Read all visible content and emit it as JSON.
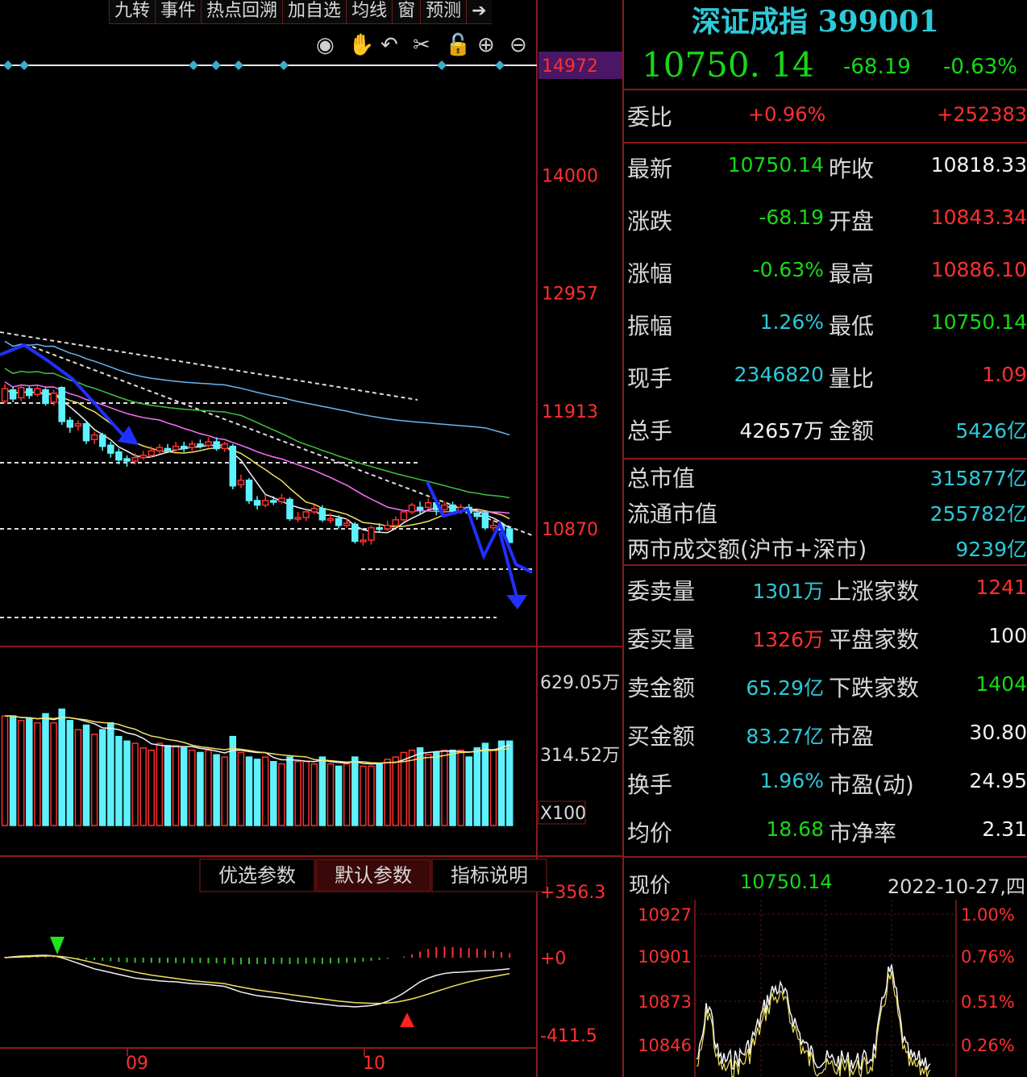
{
  "toolbar": [
    "九转",
    "事件",
    "热点回溯",
    "加自选",
    "均线",
    "窗",
    "预测"
  ],
  "header": {
    "title": "深证成指 399001",
    "price": "10750. 14",
    "change": "-68.19",
    "change_pct": "-0.63%"
  },
  "weibi": {
    "label": "委比",
    "pct": "+0.96%",
    "value": "+252383"
  },
  "quote_rows": [
    {
      "l1": "最新",
      "v1": "10750.14",
      "c1": "g",
      "l2": "昨收",
      "v2": "10818.33",
      "c2": "w"
    },
    {
      "l1": "涨跌",
      "v1": "-68.19",
      "c1": "g",
      "l2": "开盘",
      "v2": "10843.34",
      "c2": "r"
    },
    {
      "l1": "涨幅",
      "v1": "-0.63%",
      "c1": "g",
      "l2": "最高",
      "v2": "10886.10",
      "c2": "r"
    },
    {
      "l1": "振幅",
      "v1": "1.26%",
      "c1": "c",
      "l2": "最低",
      "v2": "10750.14",
      "c2": "g"
    },
    {
      "l1": "现手",
      "v1": "2346820",
      "c1": "c",
      "l2": "量比",
      "v2": "1.09",
      "c2": "r"
    },
    {
      "l1": "总手",
      "v1": "42657万",
      "c1": "w",
      "l2": "金额",
      "v2": "5426亿",
      "c2": "c"
    }
  ],
  "market_rows": [
    {
      "label": "总市值",
      "value": "315877亿"
    },
    {
      "label": "流通市值",
      "value": "255782亿"
    },
    {
      "label": "两市成交额(沪市+深市)",
      "value": "9239亿"
    }
  ],
  "order_rows": [
    {
      "l1": "委卖量",
      "v1": "1301万",
      "c1": "c",
      "l2": "上涨家数",
      "v2": "1241",
      "c2": "r"
    },
    {
      "l1": "委买量",
      "v1": "1326万",
      "c1": "r",
      "l2": "平盘家数",
      "v2": "100",
      "c2": "w"
    },
    {
      "l1": "卖金额",
      "v1": "65.29亿",
      "c1": "c",
      "l2": "下跌家数",
      "v2": "1404",
      "c2": "g"
    },
    {
      "l1": "买金额",
      "v1": "83.27亿",
      "c1": "c",
      "l2": "市盈",
      "v2": "30.80",
      "c2": "w"
    },
    {
      "l1": "换手",
      "v1": "1.96%",
      "c1": "c",
      "l2": "市盈(动)",
      "v2": "24.95",
      "c2": "w"
    },
    {
      "l1": "均价",
      "v1": "18.68",
      "c1": "g",
      "l2": "市净率",
      "v2": "2.31",
      "c2": "w"
    }
  ],
  "mini_chart": {
    "label": "现价",
    "price": "10750.14",
    "date": "2022-10-27,四",
    "left_ticks": [
      "10927",
      "10901",
      "10873",
      "10846"
    ],
    "right_ticks": [
      "1.00%",
      "0.76%",
      "0.51%",
      "0.26%"
    ]
  },
  "indicator_tabs": [
    "优选参数",
    "默认参数",
    "指标说明"
  ],
  "chart_data": {
    "type": "candlestick",
    "price_axis_ticks": [
      "14972",
      "14000",
      "12957",
      "11913",
      "10870"
    ],
    "price_axis_values": [
      14972,
      14000,
      12957,
      11913,
      10870
    ],
    "volume_axis_ticks": [
      "629.05万",
      "314.52万",
      "X100"
    ],
    "macd_axis_ticks": [
      "+356.3",
      "+0",
      "-411.5"
    ],
    "x_labels": [
      "09",
      "10"
    ],
    "candles": [
      {
        "o": 12000,
        "c": 12110,
        "h": 12150,
        "l": 11980
      },
      {
        "o": 12100,
        "c": 12020,
        "h": 12130,
        "l": 11990
      },
      {
        "o": 12030,
        "c": 12120,
        "h": 12140,
        "l": 12000
      },
      {
        "o": 12110,
        "c": 12050,
        "h": 12130,
        "l": 12020
      },
      {
        "o": 12060,
        "c": 12110,
        "h": 12140,
        "l": 12040
      },
      {
        "o": 12100,
        "c": 11980,
        "h": 12120,
        "l": 11960
      },
      {
        "o": 11990,
        "c": 12070,
        "h": 12100,
        "l": 11960
      },
      {
        "o": 12120,
        "c": 11820,
        "h": 12130,
        "l": 11790
      },
      {
        "o": 11830,
        "c": 11770,
        "h": 11860,
        "l": 11720
      },
      {
        "o": 11780,
        "c": 11800,
        "h": 11830,
        "l": 11740
      },
      {
        "o": 11800,
        "c": 11650,
        "h": 11820,
        "l": 11620
      },
      {
        "o": 11660,
        "c": 11700,
        "h": 11730,
        "l": 11620
      },
      {
        "o": 11700,
        "c": 11600,
        "h": 11720,
        "l": 11560
      },
      {
        "o": 11610,
        "c": 11540,
        "h": 11640,
        "l": 11500
      },
      {
        "o": 11550,
        "c": 11480,
        "h": 11580,
        "l": 11440
      },
      {
        "o": 11490,
        "c": 11470,
        "h": 11520,
        "l": 11420
      },
      {
        "o": 11470,
        "c": 11500,
        "h": 11540,
        "l": 11440
      },
      {
        "o": 11500,
        "c": 11520,
        "h": 11560,
        "l": 11480
      },
      {
        "o": 11520,
        "c": 11560,
        "h": 11600,
        "l": 11500
      },
      {
        "o": 11560,
        "c": 11590,
        "h": 11620,
        "l": 11530
      },
      {
        "o": 11580,
        "c": 11570,
        "h": 11620,
        "l": 11540
      },
      {
        "o": 11570,
        "c": 11600,
        "h": 11640,
        "l": 11550
      },
      {
        "o": 11600,
        "c": 11580,
        "h": 11640,
        "l": 11550
      },
      {
        "o": 11590,
        "c": 11620,
        "h": 11650,
        "l": 11560
      },
      {
        "o": 11620,
        "c": 11610,
        "h": 11660,
        "l": 11580
      },
      {
        "o": 11610,
        "c": 11640,
        "h": 11680,
        "l": 11590
      },
      {
        "o": 11640,
        "c": 11580,
        "h": 11680,
        "l": 11560
      },
      {
        "o": 11580,
        "c": 11620,
        "h": 11640,
        "l": 11550
      },
      {
        "o": 11600,
        "c": 11250,
        "h": 11620,
        "l": 11220
      },
      {
        "o": 11260,
        "c": 11300,
        "h": 11350,
        "l": 11230
      },
      {
        "o": 11300,
        "c": 11120,
        "h": 11320,
        "l": 11090
      },
      {
        "o": 11120,
        "c": 11080,
        "h": 11160,
        "l": 11040
      },
      {
        "o": 11080,
        "c": 11120,
        "h": 11170,
        "l": 11060
      },
      {
        "o": 11120,
        "c": 11110,
        "h": 11160,
        "l": 11080
      },
      {
        "o": 11110,
        "c": 11140,
        "h": 11180,
        "l": 11090
      },
      {
        "o": 11130,
        "c": 10960,
        "h": 11150,
        "l": 10940
      },
      {
        "o": 10960,
        "c": 10970,
        "h": 11020,
        "l": 10930
      },
      {
        "o": 10970,
        "c": 11020,
        "h": 11040,
        "l": 10940
      },
      {
        "o": 11020,
        "c": 11050,
        "h": 11080,
        "l": 11000
      },
      {
        "o": 11050,
        "c": 10950,
        "h": 11080,
        "l": 10930
      },
      {
        "o": 10950,
        "c": 10960,
        "h": 11010,
        "l": 10920
      },
      {
        "o": 10960,
        "c": 10900,
        "h": 10990,
        "l": 10870
      },
      {
        "o": 10900,
        "c": 10920,
        "h": 10960,
        "l": 10880
      },
      {
        "o": 10910,
        "c": 10760,
        "h": 10930,
        "l": 10740
      },
      {
        "o": 10760,
        "c": 10770,
        "h": 10830,
        "l": 10720
      },
      {
        "o": 10770,
        "c": 10880,
        "h": 10900,
        "l": 10730
      },
      {
        "o": 10880,
        "c": 10870,
        "h": 10920,
        "l": 10840
      },
      {
        "o": 10870,
        "c": 10900,
        "h": 10940,
        "l": 10850
      },
      {
        "o": 10900,
        "c": 10950,
        "h": 10980,
        "l": 10880
      },
      {
        "o": 10950,
        "c": 11020,
        "h": 11040,
        "l": 10930
      },
      {
        "o": 11020,
        "c": 11080,
        "h": 11100,
        "l": 11000
      },
      {
        "o": 11060,
        "c": 11040,
        "h": 11110,
        "l": 11000
      },
      {
        "o": 11060,
        "c": 11100,
        "h": 11140,
        "l": 11040
      },
      {
        "o": 11100,
        "c": 11040,
        "h": 11120,
        "l": 10990
      },
      {
        "o": 11040,
        "c": 11080,
        "h": 11110,
        "l": 11010
      },
      {
        "o": 11080,
        "c": 11030,
        "h": 11110,
        "l": 11000
      },
      {
        "o": 11030,
        "c": 11060,
        "h": 11090,
        "l": 11000
      },
      {
        "o": 11060,
        "c": 11010,
        "h": 11090,
        "l": 10980
      },
      {
        "o": 11010,
        "c": 10980,
        "h": 11030,
        "l": 10950
      },
      {
        "o": 11010,
        "c": 10880,
        "h": 11030,
        "l": 10860
      },
      {
        "o": 10880,
        "c": 10900,
        "h": 10950,
        "l": 10850
      },
      {
        "o": 10900,
        "c": 10860,
        "h": 10920,
        "l": 10830
      },
      {
        "o": 10870,
        "c": 10750,
        "h": 10890,
        "l": 10750
      }
    ],
    "volume_values": [
      4.8,
      4.8,
      4.6,
      4.7,
      4.5,
      4.9,
      4.5,
      5.1,
      4.6,
      4.2,
      4.4,
      4.0,
      4.2,
      4.5,
      3.9,
      3.7,
      3.6,
      3.4,
      3.3,
      3.6,
      3.5,
      3.5,
      3.4,
      3.3,
      3.2,
      3.3,
      3.1,
      3.0,
      3.9,
      3.2,
      3.0,
      2.9,
      3.0,
      2.8,
      2.7,
      3.0,
      2.8,
      2.8,
      2.7,
      3.0,
      2.7,
      2.6,
      2.7,
      3.0,
      2.6,
      2.6,
      2.7,
      2.9,
      3.0,
      3.2,
      3.3,
      3.4,
      3.1,
      3.2,
      3.3,
      3.3,
      3.3,
      3.0,
      3.4,
      3.6,
      3.3,
      3.7,
      3.7
    ],
    "macd_hist": [
      10,
      10,
      12,
      12,
      14,
      15,
      13,
      8,
      2,
      -8,
      -15,
      -22,
      -28,
      -32,
      -38,
      -42,
      -46,
      -44,
      -46,
      -48,
      -46,
      -48,
      -50,
      -50,
      -48,
      -52,
      -50,
      -54,
      -62,
      -60,
      -58,
      -56,
      -58,
      -56,
      -55,
      -58,
      -56,
      -54,
      -52,
      -56,
      -52,
      -50,
      -46,
      -44,
      -36,
      -28,
      -20,
      -10,
      0,
      10,
      30,
      55,
      80,
      95,
      100,
      96,
      90,
      85,
      80,
      70,
      60,
      50,
      40
    ],
    "macd_dif": [
      0,
      5,
      8,
      10,
      12,
      13,
      10,
      0,
      -15,
      -30,
      -45,
      -60,
      -70,
      -80,
      -90,
      -100,
      -110,
      -115,
      -120,
      -125,
      -128,
      -130,
      -135,
      -140,
      -142,
      -145,
      -150,
      -155,
      -170,
      -185,
      -195,
      -205,
      -210,
      -215,
      -220,
      -228,
      -235,
      -240,
      -245,
      -250,
      -255,
      -260,
      -262,
      -265,
      -262,
      -258,
      -250,
      -235,
      -215,
      -190,
      -160,
      -130,
      -110,
      -95,
      -85,
      -80,
      -78,
      -75,
      -72,
      -70,
      -68,
      -64,
      -60
    ],
    "macd_dea": [
      0,
      2,
      4,
      6,
      8,
      9,
      9,
      6,
      0,
      -8,
      -18,
      -28,
      -38,
      -48,
      -58,
      -68,
      -78,
      -86,
      -94,
      -100,
      -106,
      -112,
      -118,
      -124,
      -128,
      -132,
      -136,
      -140,
      -150,
      -158,
      -166,
      -174,
      -180,
      -186,
      -192,
      -198,
      -204,
      -210,
      -216,
      -222,
      -228,
      -234,
      -238,
      -242,
      -244,
      -246,
      -246,
      -244,
      -240,
      -232,
      -222,
      -210,
      -196,
      -182,
      -168,
      -154,
      -142,
      -130,
      -120,
      -110,
      -102,
      -94,
      -86
    ]
  }
}
